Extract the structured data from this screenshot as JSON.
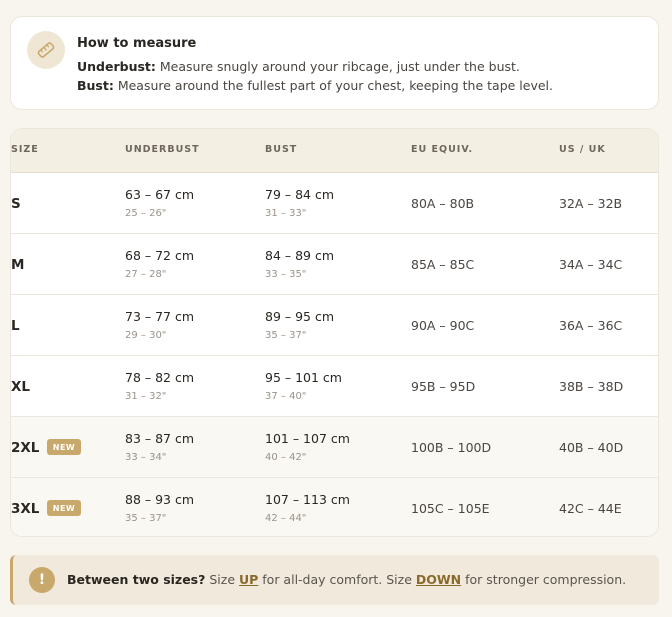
{
  "measure": {
    "title": "How to measure",
    "underbust_label": "Underbust:",
    "underbust_text": "Measure snugly around your ribcage, just under the bust.",
    "bust_label": "Bust:",
    "bust_text": "Measure around the fullest part of your chest, keeping the tape level.",
    "icon": "tape-measure-icon"
  },
  "table": {
    "headers": [
      "SIZE",
      "UNDERBUST",
      "BUST",
      "EU EQUIV.",
      "US / UK"
    ],
    "rows": [
      {
        "size": "S",
        "underbust_cm": "63 – 67 cm",
        "underbust_in": "25 – 26\"",
        "bust_cm": "79 – 84 cm",
        "bust_in": "31 – 33\"",
        "eu": "80A – 80B",
        "us": "32A – 32B"
      },
      {
        "size": "M",
        "underbust_cm": "68 – 72 cm",
        "underbust_in": "27 – 28\"",
        "bust_cm": "84 – 89 cm",
        "bust_in": "33 – 35\"",
        "eu": "85A – 85C",
        "us": "34A – 34C"
      },
      {
        "size": "L",
        "underbust_cm": "73 – 77 cm",
        "underbust_in": "29 – 30\"",
        "bust_cm": "89 – 95 cm",
        "bust_in": "35 – 37\"",
        "eu": "90A – 90C",
        "us": "36A – 36C"
      },
      {
        "size": "XL",
        "underbust_cm": "78 – 82 cm",
        "underbust_in": "31 – 32\"",
        "bust_cm": "95 – 101 cm",
        "bust_in": "37 – 40\"",
        "eu": "95B – 95D",
        "us": "38B – 38D"
      },
      {
        "size": "2XL",
        "badge": "NEW",
        "underbust_cm": "83 – 87 cm",
        "underbust_in": "33 – 34\"",
        "bust_cm": "101 – 107 cm",
        "bust_in": "40 – 42\"",
        "eu": "100B – 100D",
        "us": "40B – 40D"
      },
      {
        "size": "3XL",
        "badge": "NEW",
        "underbust_cm": "88 – 93 cm",
        "underbust_in": "35 – 37\"",
        "bust_cm": "107 – 113 cm",
        "bust_in": "42 – 44\"",
        "eu": "105C – 105E",
        "us": "42C – 44E"
      }
    ]
  },
  "tip": {
    "icon_glyph": "!",
    "lead": "Between two sizes?",
    "text1": " Size ",
    "up": "UP",
    "text2": " for all-day comfort. Size ",
    "down": "DOWN",
    "text3": " for stronger compression."
  },
  "colors": {
    "accent": "#c9a96b",
    "background": "#f8f5ee"
  }
}
